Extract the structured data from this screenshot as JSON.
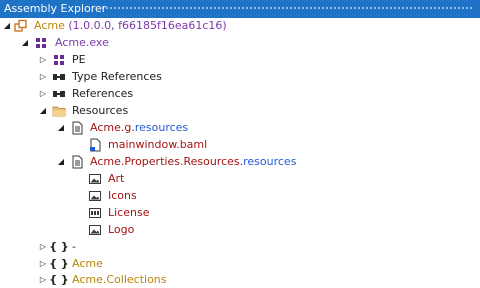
{
  "window": {
    "title": "Assembly Explorer"
  },
  "colors": {
    "titlebar": "#1f73c6",
    "text": "#1e1e1e",
    "red": "#a31515",
    "blue": "#1f5bd6",
    "olive": "#b8860b",
    "purple": "#7a3aa8"
  },
  "tree": {
    "assembly": {
      "name": "Acme",
      "info": "(1.0.0.0, f66185f16ea61c16)"
    },
    "module": {
      "name": "Acme.exe"
    },
    "pe": {
      "label": "PE"
    },
    "type_references": {
      "label": "Type References"
    },
    "references": {
      "label": "References"
    },
    "resources": {
      "label": "Resources"
    },
    "g_resources": {
      "name": "Acme.g.",
      "suffix": "resources"
    },
    "baml": {
      "name": "mainwindow.baml"
    },
    "prop_resources": {
      "name": "Acme.Properties.Resources.",
      "suffix": "resources"
    },
    "items": [
      {
        "label": "Art",
        "icon": "image-icon"
      },
      {
        "label": "Icons",
        "icon": "image-icon"
      },
      {
        "label": "License",
        "icon": "text-resource-icon"
      },
      {
        "label": "Logo",
        "icon": "image-icon"
      }
    ],
    "namespaces": [
      {
        "name": "-"
      },
      {
        "name": "Acme"
      },
      {
        "name": "Acme.Collections"
      }
    ]
  }
}
